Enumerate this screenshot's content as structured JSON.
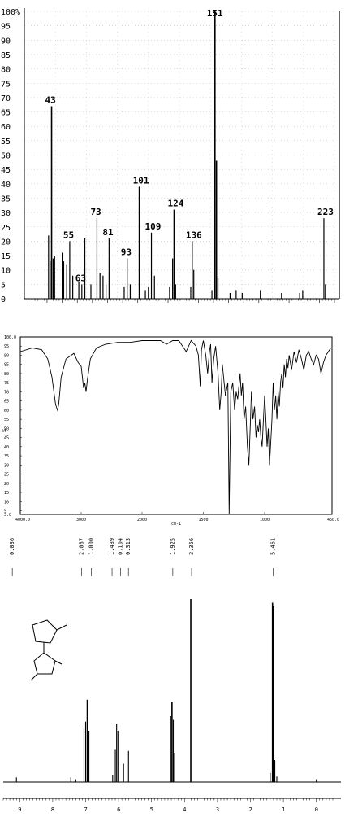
{
  "chart_data": [
    {
      "type": "bar",
      "ylim": [
        0,
        100
      ],
      "ytick_labels": [
        "100%",
        "95",
        "90",
        "85",
        "80",
        "75",
        "70",
        "65",
        "60",
        "55",
        "50",
        "45",
        "40",
        "35",
        "30",
        "25",
        "20",
        "15",
        "10",
        "5",
        "0"
      ],
      "xlim": [
        25,
        230
      ],
      "peak_labels": [
        "43",
        "55",
        "63",
        "73",
        "81",
        "93",
        "101",
        "109",
        "124",
        "136",
        "151",
        "223"
      ],
      "peaks": [
        {
          "x": 41,
          "y": 22
        },
        {
          "x": 42,
          "y": 13
        },
        {
          "x": 43,
          "y": 67
        },
        {
          "x": 44,
          "y": 14
        },
        {
          "x": 45,
          "y": 15
        },
        {
          "x": 50,
          "y": 16
        },
        {
          "x": 51,
          "y": 13
        },
        {
          "x": 53,
          "y": 12
        },
        {
          "x": 55,
          "y": 20
        },
        {
          "x": 57,
          "y": 8
        },
        {
          "x": 61,
          "y": 6
        },
        {
          "x": 63,
          "y": 5
        },
        {
          "x": 65,
          "y": 21
        },
        {
          "x": 69,
          "y": 5
        },
        {
          "x": 73,
          "y": 28
        },
        {
          "x": 75,
          "y": 9
        },
        {
          "x": 77,
          "y": 8
        },
        {
          "x": 79,
          "y": 5
        },
        {
          "x": 81,
          "y": 21
        },
        {
          "x": 91,
          "y": 4
        },
        {
          "x": 93,
          "y": 14
        },
        {
          "x": 95,
          "y": 5
        },
        {
          "x": 101,
          "y": 39
        },
        {
          "x": 105,
          "y": 3
        },
        {
          "x": 107,
          "y": 4
        },
        {
          "x": 109,
          "y": 23
        },
        {
          "x": 111,
          "y": 8
        },
        {
          "x": 121,
          "y": 4
        },
        {
          "x": 123,
          "y": 14
        },
        {
          "x": 124,
          "y": 31
        },
        {
          "x": 125,
          "y": 5
        },
        {
          "x": 135,
          "y": 4
        },
        {
          "x": 136,
          "y": 20
        },
        {
          "x": 137,
          "y": 10
        },
        {
          "x": 149,
          "y": 3
        },
        {
          "x": 151,
          "y": 100
        },
        {
          "x": 152,
          "y": 48
        },
        {
          "x": 153,
          "y": 7
        },
        {
          "x": 161,
          "y": 2
        },
        {
          "x": 165,
          "y": 3
        },
        {
          "x": 169,
          "y": 2
        },
        {
          "x": 181,
          "y": 3
        },
        {
          "x": 195,
          "y": 2
        },
        {
          "x": 207,
          "y": 2
        },
        {
          "x": 209,
          "y": 3
        },
        {
          "x": 223,
          "y": 28
        },
        {
          "x": 224,
          "y": 5
        }
      ]
    },
    {
      "type": "line",
      "ytick_labels": [
        "100.0",
        "95",
        "90",
        "85",
        "80",
        "75",
        "70",
        "65",
        "60",
        "55",
        "50",
        "45",
        "40",
        "35",
        "30",
        "25",
        "20",
        "15",
        "10",
        "5",
        "3.0"
      ],
      "ylabel": "%T",
      "xtick_labels": [
        "4000.0",
        "3000",
        "2000",
        "1500",
        "1000",
        "450.0"
      ],
      "xlabel": "cm-1",
      "ylim": [
        3,
        100
      ],
      "points": [
        [
          4000,
          92
        ],
        [
          3800,
          94
        ],
        [
          3650,
          93
        ],
        [
          3550,
          88
        ],
        [
          3480,
          78
        ],
        [
          3420,
          63
        ],
        [
          3390,
          60
        ],
        [
          3370,
          63
        ],
        [
          3330,
          78
        ],
        [
          3250,
          88
        ],
        [
          3120,
          91
        ],
        [
          3050,
          86
        ],
        [
          3000,
          84
        ],
        [
          2960,
          72
        ],
        [
          2940,
          75
        ],
        [
          2920,
          70
        ],
        [
          2900,
          76
        ],
        [
          2850,
          88
        ],
        [
          2750,
          94
        ],
        [
          2600,
          96
        ],
        [
          2400,
          97
        ],
        [
          2200,
          97
        ],
        [
          2000,
          98
        ],
        [
          1850,
          98
        ],
        [
          1800,
          96
        ],
        [
          1750,
          98
        ],
        [
          1700,
          98
        ],
        [
          1680,
          96
        ],
        [
          1640,
          92
        ],
        [
          1620,
          95
        ],
        [
          1600,
          98
        ],
        [
          1560,
          95
        ],
        [
          1540,
          90
        ],
        [
          1525,
          73
        ],
        [
          1515,
          93
        ],
        [
          1500,
          98
        ],
        [
          1480,
          90
        ],
        [
          1465,
          80
        ],
        [
          1450,
          92
        ],
        [
          1440,
          96
        ],
        [
          1430,
          75
        ],
        [
          1415,
          88
        ],
        [
          1400,
          95
        ],
        [
          1380,
          80
        ],
        [
          1366,
          60
        ],
        [
          1354,
          70
        ],
        [
          1345,
          85
        ],
        [
          1330,
          75
        ],
        [
          1320,
          68
        ],
        [
          1300,
          75
        ],
        [
          1289,
          3
        ],
        [
          1276,
          70
        ],
        [
          1260,
          75
        ],
        [
          1245,
          60
        ],
        [
          1232,
          70
        ],
        [
          1220,
          66
        ],
        [
          1200,
          80
        ],
        [
          1190,
          68
        ],
        [
          1180,
          75
        ],
        [
          1168,
          55
        ],
        [
          1155,
          62
        ],
        [
          1140,
          40
        ],
        [
          1128,
          30
        ],
        [
          1118,
          50
        ],
        [
          1108,
          70
        ],
        [
          1095,
          55
        ],
        [
          1082,
          62
        ],
        [
          1070,
          45
        ],
        [
          1060,
          52
        ],
        [
          1050,
          48
        ],
        [
          1040,
          55
        ],
        [
          1030,
          45
        ],
        [
          1020,
          40
        ],
        [
          1010,
          55
        ],
        [
          1000,
          68
        ],
        [
          990,
          55
        ],
        [
          980,
          40
        ],
        [
          970,
          50
        ],
        [
          960,
          30
        ],
        [
          950,
          42
        ],
        [
          940,
          55
        ],
        [
          930,
          75
        ],
        [
          920,
          60
        ],
        [
          910,
          68
        ],
        [
          900,
          55
        ],
        [
          890,
          70
        ],
        [
          880,
          62
        ],
        [
          870,
          75
        ],
        [
          860,
          80
        ],
        [
          850,
          72
        ],
        [
          840,
          85
        ],
        [
          830,
          78
        ],
        [
          820,
          88
        ],
        [
          810,
          83
        ],
        [
          800,
          90
        ],
        [
          780,
          82
        ],
        [
          760,
          92
        ],
        [
          740,
          86
        ],
        [
          720,
          93
        ],
        [
          700,
          88
        ],
        [
          680,
          82
        ],
        [
          660,
          90
        ],
        [
          640,
          92
        ],
        [
          620,
          88
        ],
        [
          600,
          85
        ],
        [
          580,
          90
        ],
        [
          560,
          88
        ],
        [
          540,
          80
        ],
        [
          520,
          86
        ],
        [
          500,
          90
        ],
        [
          480,
          92
        ],
        [
          460,
          94
        ],
        [
          450,
          94
        ]
      ]
    },
    {
      "type": "line",
      "integration_labels": [
        "0.036",
        "2.087",
        "1.000",
        "1.489",
        "0.104",
        "0.313",
        "1.925",
        "3.356",
        "5.461"
      ],
      "xtick_labels": [
        "9",
        "8",
        "7",
        "6",
        "5",
        "4",
        "3",
        "2",
        "1",
        "0"
      ],
      "xlim": [
        9.5,
        -0.5
      ],
      "x_unit": "ppm",
      "peaks": [
        {
          "x": 9.1,
          "y": 2.5
        },
        {
          "x": 7.45,
          "y": 2.5
        },
        {
          "x": 7.3,
          "y": 1.5
        },
        {
          "x": 7.05,
          "y": 30
        },
        {
          "x": 7.0,
          "y": 33
        },
        {
          "x": 6.95,
          "y": 45
        },
        {
          "x": 6.9,
          "y": 28
        },
        {
          "x": 6.18,
          "y": 4
        },
        {
          "x": 6.1,
          "y": 18
        },
        {
          "x": 6.06,
          "y": 32
        },
        {
          "x": 6.02,
          "y": 28
        },
        {
          "x": 5.85,
          "y": 10
        },
        {
          "x": 5.7,
          "y": 17
        },
        {
          "x": 4.42,
          "y": 36
        },
        {
          "x": 4.38,
          "y": 44
        },
        {
          "x": 4.34,
          "y": 34
        },
        {
          "x": 4.3,
          "y": 16
        },
        {
          "x": 3.81,
          "y": 100
        },
        {
          "x": 1.4,
          "y": 5
        },
        {
          "x": 1.33,
          "y": 98
        },
        {
          "x": 1.3,
          "y": 96
        },
        {
          "x": 1.26,
          "y": 12
        },
        {
          "x": 1.2,
          "y": 3
        },
        {
          "x": 0.0,
          "y": 1.5
        }
      ]
    }
  ]
}
